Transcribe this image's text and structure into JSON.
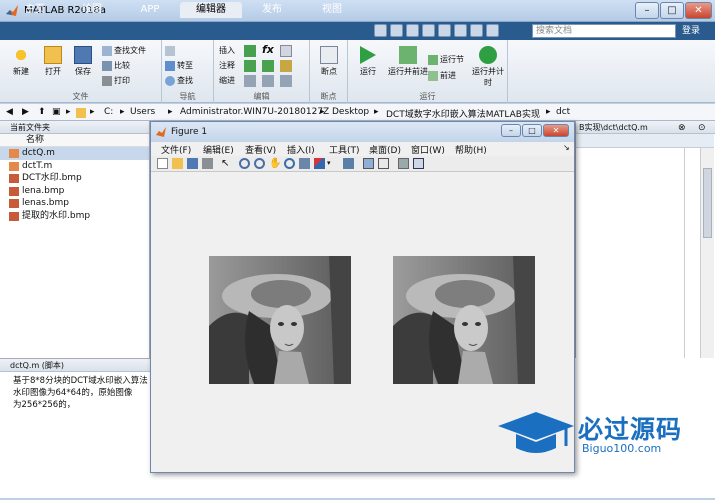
{
  "app": {
    "title": "MATLAB R2018a"
  },
  "tabs": [
    "主页",
    "绘图",
    "APP",
    "编辑器",
    "发布",
    "视图"
  ],
  "active_tab": "编辑器",
  "search": {
    "placeholder": "搜索文档"
  },
  "login_label": "登录",
  "ribbon": {
    "file_group": {
      "label": "文件",
      "new": "新建",
      "open": "打开",
      "save": "保存",
      "find_files": "查找文件",
      "compare": "比较",
      "print": "打印"
    },
    "nav_group": {
      "label": "导航",
      "goto": "转至",
      "find": "查找"
    },
    "edit_group": {
      "label": "编辑",
      "insert": "插入",
      "comment": "注释",
      "indent": "缩进",
      "fx": "fx"
    },
    "breakpoints_group": {
      "label": "断点",
      "breakpoints": "断点"
    },
    "run_group": {
      "label": "运行",
      "run": "运行",
      "run_advance": "运行并前进",
      "run_section": "运行节",
      "advance": "前进",
      "run_time": "运行并计时"
    }
  },
  "path": [
    "C:",
    "Users",
    "Administrator.WIN7U-20180127Z",
    "Desktop",
    "DCT域数字水印嵌入算法MATLAB实现",
    "dct"
  ],
  "current_folder": {
    "title": "当前文件夹",
    "column": "名称",
    "files": [
      "dctQ.m",
      "dctT.m",
      "DCT水印.bmp",
      "lena.bmp",
      "lenas.bmp",
      "提取的水印.bmp"
    ],
    "selected": "dctQ.m"
  },
  "details": {
    "title": "dctQ.m  (脚本)",
    "lines": [
      "基于8*8分块的DCT域水印嵌入算法",
      "水印图像为64*64的，原始图像",
      "为256*256的，"
    ]
  },
  "editor_tab": "B实现\\dct\\dctQ.m",
  "figure": {
    "title": "Figure 1",
    "menu": [
      "文件(F)",
      "编辑(E)",
      "查看(V)",
      "插入(I)",
      "工具(T)",
      "桌面(D)",
      "窗口(W)",
      "帮助(H)"
    ]
  },
  "watermark": {
    "brand": "必过源码",
    "url": "Biguo100.com"
  },
  "colors": {
    "tabbar": "#2a5b8f",
    "accent": "#1a6fc0"
  }
}
